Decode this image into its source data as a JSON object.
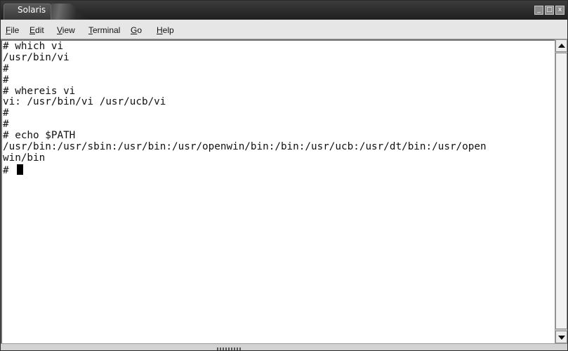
{
  "window": {
    "title": "Solaris",
    "controls": [
      "minimize-icon",
      "maximize-icon",
      "close-icon"
    ],
    "control_glyphs": {
      "minimize": "_",
      "maximize": "□",
      "close": "x"
    }
  },
  "menu": [
    {
      "label": "File",
      "mnemonic": "F",
      "rest": "ile"
    },
    {
      "label": "Edit",
      "mnemonic": "E",
      "rest": "dit"
    },
    {
      "label": "View",
      "mnemonic": "V",
      "rest": "iew"
    },
    {
      "label": "Terminal",
      "mnemonic": "T",
      "rest": "erminal"
    },
    {
      "label": "Go",
      "mnemonic": "G",
      "rest": "o"
    },
    {
      "label": "Help",
      "mnemonic": "H",
      "rest": "elp"
    }
  ],
  "terminal": {
    "lines": [
      "# which vi",
      "/usr/bin/vi",
      "#",
      "#",
      "# whereis vi",
      "vi: /usr/bin/vi /usr/ucb/vi",
      "#",
      "#",
      "# echo $PATH",
      "/usr/bin:/usr/sbin:/usr/bin:/usr/openwin/bin:/bin:/usr/ucb:/usr/dt/bin:/usr/open",
      "win/bin"
    ],
    "prompt": "# "
  },
  "colors": {
    "titlebar": "#2a2a2a",
    "terminal_bg": "#ffffff",
    "terminal_fg": "#111111"
  }
}
